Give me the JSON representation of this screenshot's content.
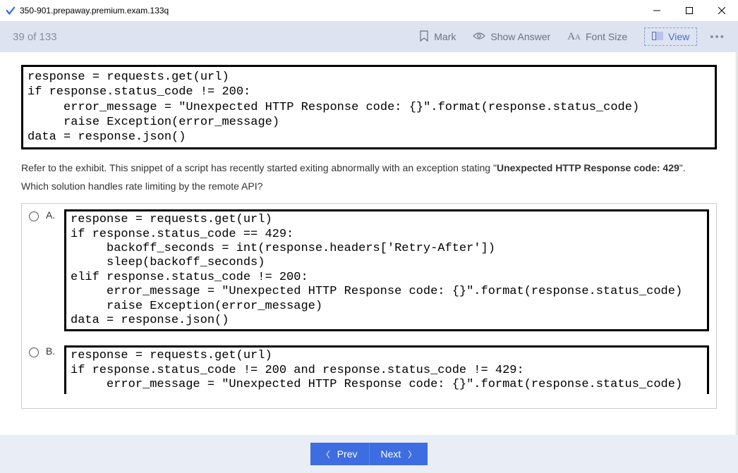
{
  "window": {
    "title": "350-901.prepaway.premium.exam.133q"
  },
  "toolbar": {
    "counter": "39 of 133",
    "mark": "Mark",
    "show_answer": "Show Answer",
    "font_size": "Font Size",
    "view": "View",
    "more": "•••"
  },
  "exhibit_code": "response = requests.get(url)\nif response.status_code != 200:\n     error_message = \"Unexpected HTTP Response code: {}\".format(response.status_code)\n     raise Exception(error_message)\ndata = response.json()",
  "question": {
    "line1_pre": "Refer to the exhibit. This snippet of a script has recently started exiting abnormally with an exception stating \"",
    "line1_strong": "Unexpected HTTP Response code: 429",
    "line1_post": "\".",
    "line2": "Which solution handles rate limiting by the remote API?"
  },
  "options": [
    {
      "label": "A.",
      "code": "response = requests.get(url)\nif response.status_code == 429:\n     backoff_seconds = int(response.headers['Retry-After'])\n     sleep(backoff_seconds)\nelif response.status_code != 200:\n     error_message = \"Unexpected HTTP Response code: {}\".format(response.status_code)\n     raise Exception(error_message)\ndata = response.json()"
    },
    {
      "label": "B.",
      "code": "response = requests.get(url)\nif response.status_code != 200 and response.status_code != 429:\n     error_message = \"Unexpected HTTP Response code: {}\".format(response.status_code)"
    }
  ],
  "footer": {
    "prev": "Prev",
    "next": "Next"
  }
}
